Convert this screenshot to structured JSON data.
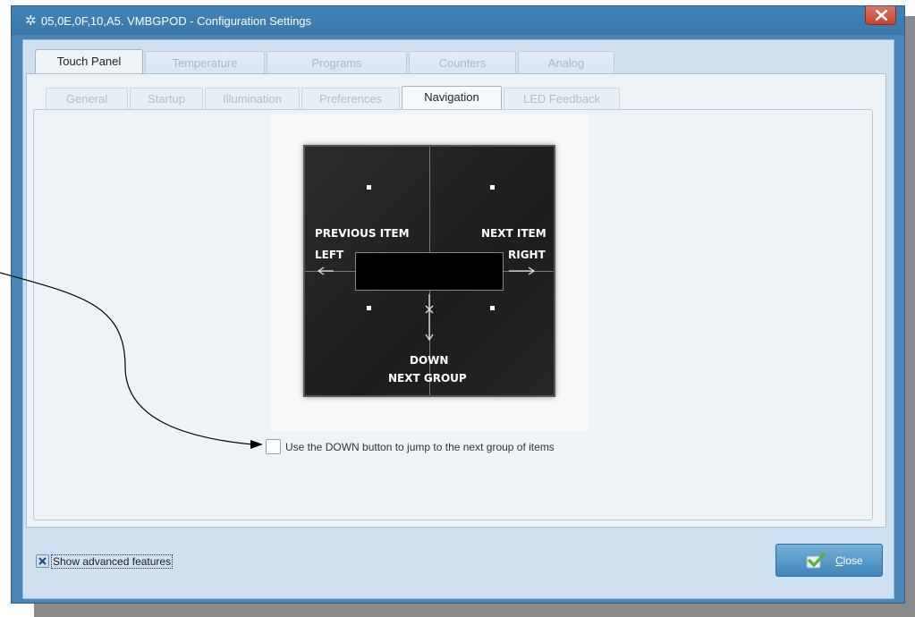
{
  "window": {
    "title": "05,0E,0F,10,A5. VMBGPOD - Configuration Settings",
    "icon": "gear-icon",
    "close_icon": "close-icon"
  },
  "tabs_main": [
    {
      "label": "Touch Panel",
      "active": true
    },
    {
      "label": "Temperature",
      "active": false
    },
    {
      "label": "Programs",
      "active": false
    },
    {
      "label": "Counters",
      "active": false
    },
    {
      "label": "Analog",
      "active": false
    }
  ],
  "tabs_sub": [
    {
      "label": "General",
      "active": false
    },
    {
      "label": "Startup",
      "active": false
    },
    {
      "label": "Illumination",
      "active": false
    },
    {
      "label": "Preferences",
      "active": false
    },
    {
      "label": "Navigation",
      "active": true
    },
    {
      "label": "LED Feedback",
      "active": false
    }
  ],
  "device": {
    "previous_item": "PREVIOUS ITEM",
    "left": "LEFT",
    "next_item": "NEXT ITEM",
    "right": "RIGHT",
    "down": "DOWN",
    "next_group": "NEXT GROUP"
  },
  "options": {
    "down_jump_label": "Use the DOWN button to jump to the next group of items",
    "down_jump_checked": false
  },
  "footer": {
    "show_advanced_label": "Show advanced features",
    "show_advanced_checked": true,
    "close_label_first": "C",
    "close_label_rest": "lose"
  },
  "colors": {
    "titlebar": "#3f84ba",
    "close_red": "#c5402e",
    "panel": "#eef3f8",
    "button_blue": "#4a8fc4"
  }
}
